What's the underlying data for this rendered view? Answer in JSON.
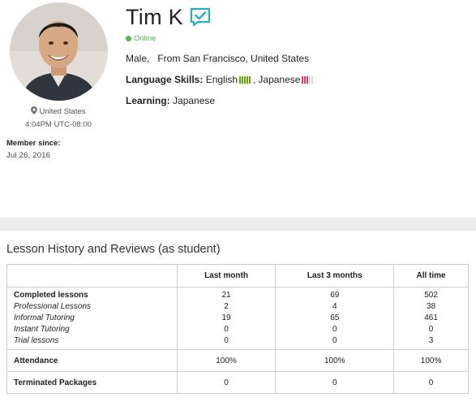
{
  "profile": {
    "name": "Tim K",
    "status": "Online",
    "sex": "Male,",
    "from": "From San Francisco, United States",
    "language_label": "Language Skills",
    "languages": [
      {
        "name": "English",
        "level": 5,
        "color": "#5fa800"
      },
      {
        "name": "Japanese",
        "level": 3,
        "color": "#d63a6b"
      }
    ],
    "learning_label": "Learning",
    "learning": "Japanese",
    "country": "United States",
    "local_time": "4:04PM UTC-08:00",
    "member_since_label": "Member since",
    "member_since": "Jul 26, 2016"
  },
  "history": {
    "title": "Lesson History and Reviews (as student)",
    "columns": [
      "",
      "Last month",
      "Last 3 months",
      "All time"
    ],
    "lesson_rows": [
      {
        "label": "Completed lessons",
        "style": "bold",
        "values": [
          "21",
          "69",
          "502"
        ]
      },
      {
        "label": "Professional Lessons",
        "style": "italic",
        "values": [
          "2",
          "4",
          "38"
        ]
      },
      {
        "label": "Informal Tutoring",
        "style": "italic",
        "values": [
          "19",
          "65",
          "461"
        ]
      },
      {
        "label": "Instant Tutoring",
        "style": "italic",
        "values": [
          "0",
          "0",
          "0"
        ]
      },
      {
        "label": "Trial lessons",
        "style": "italic",
        "values": [
          "0",
          "0",
          "3"
        ]
      }
    ],
    "attendance": {
      "label": "Attendance",
      "values": [
        "100%",
        "100%",
        "100%"
      ]
    },
    "terminated": {
      "label": "Terminated Packages",
      "values": [
        "0",
        "0",
        "0"
      ]
    }
  },
  "colors": {
    "online": "#5cb85c",
    "verified": "#27aebf",
    "band": "#ececec"
  }
}
